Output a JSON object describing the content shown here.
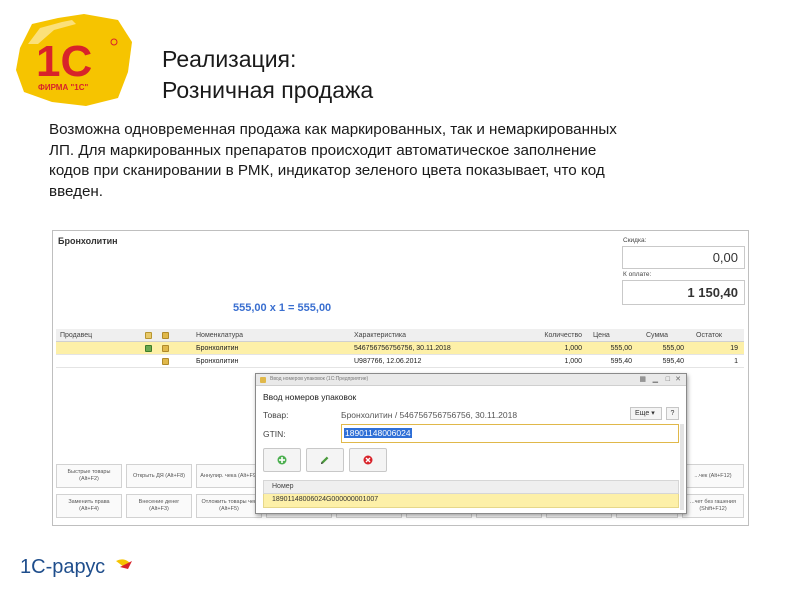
{
  "brand": {
    "logo_1c_text": "1С",
    "logo_1c_sub": "ФИРМА \"1С\"",
    "logo_rarus_text": "1С-рарус"
  },
  "slide": {
    "title_line1": "Реализация:",
    "title_line2": "Розничная продажа",
    "description": "Возможна одновременная продажа как маркированных, так и немаркированных ЛП. Для маркированных препаратов происходит автоматическое заполнение кодов при сканировании в РМК, индикатор зеленого цвета показывает, что код введен."
  },
  "app": {
    "product_name": "Бронхолитин",
    "calc_line": "555,00  x 1  = 555,00",
    "discount_label": "Скидка:",
    "discount_value": "0,00",
    "to_pay_label": "К оплате:",
    "to_pay_value": "1 150,40",
    "table": {
      "headers": {
        "seller": "Продавец",
        "name": "Номенклатура",
        "characteristic": "Характеристика",
        "quantity": "Количество",
        "price": "Цена",
        "sum": "Сумма",
        "rest": "Остаток"
      },
      "rows": [
        {
          "seller": "",
          "name": "Бронхолитин",
          "characteristic": "546756756756756, 30.11.2018",
          "quantity": "1,000",
          "price": "555,00",
          "sum": "555,00",
          "rest": "19",
          "selected": true,
          "marking_indicator": "green"
        },
        {
          "seller": "",
          "name": "Бронхолитин",
          "characteristic": "U987766, 12.06.2012",
          "quantity": "1,000",
          "price": "595,40",
          "sum": "595,40",
          "rest": "1",
          "selected": false,
          "marking_indicator": "none"
        }
      ]
    },
    "function_buttons": [
      "Быстрые товары (Alt+F2)",
      "Открыть ДЯ (Alt+F8)",
      "Аннулир. чека (Alt+F9)",
      "...чек (Alt+F12)",
      "Заменить права (Alt+F4)",
      "Внесение денег (Alt+F3)",
      "Отложить товары чек (Alt+F5)",
      "...чет без гашения (Shift+F12)"
    ]
  },
  "dialog": {
    "window_title": "Ввод номеров упаковок (1С:Предприятие)",
    "heading": "Ввод номеров упаковок",
    "goods_label": "Товар:",
    "goods_value": "Бронхолитин / 546756756756756, 30.11.2018",
    "gtin_label": "GTIN:",
    "gtin_value": "18901148006024",
    "more_button": "Еще ▾",
    "help_button": "?",
    "toolbar": {
      "add_icon": "plus-circle-icon",
      "edit_icon": "pencil-icon",
      "delete_icon": "delete-circle-icon"
    },
    "grid_header": "Номер",
    "grid_rows": [
      "18901148006024G000000001007"
    ]
  },
  "colors": {
    "accent_blue": "#3a6fd0",
    "selection_yellow": "#fdf0a8",
    "logo_yellow": "#f6c400",
    "logo_red": "#d8232a",
    "green_indicator": "#6aa84f"
  }
}
